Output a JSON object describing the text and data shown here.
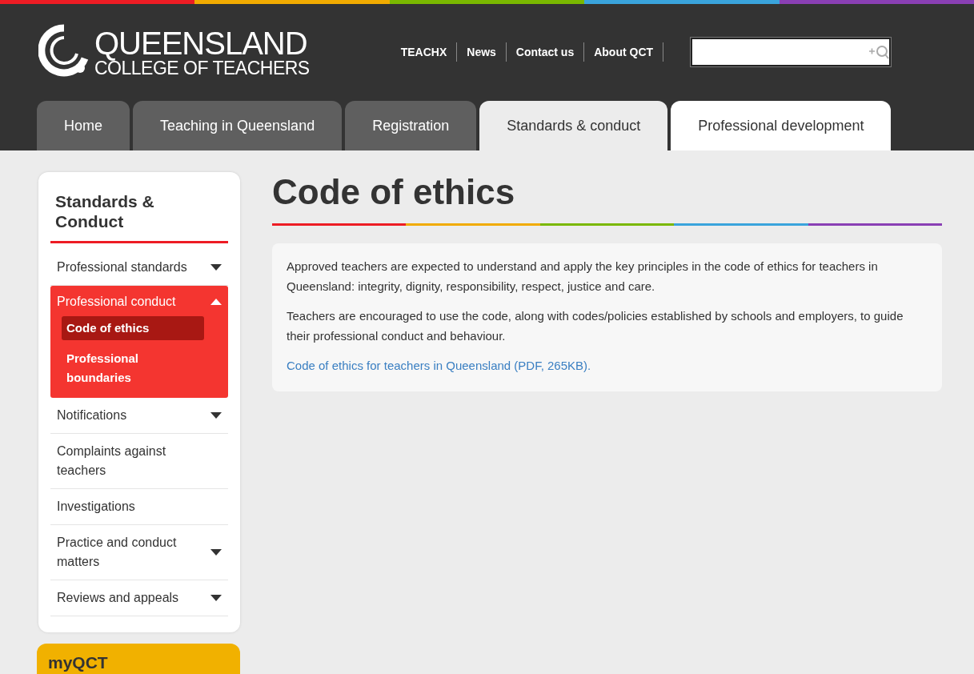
{
  "logo": {
    "line_1": "QUEENSLAND",
    "line_2": "COLLEGE OF TEACHERS"
  },
  "top_links": [
    "TEACHX",
    "News",
    "Contact us",
    "About QCT"
  ],
  "tabs": [
    {
      "label": "Home",
      "selected": false,
      "highlighted": false
    },
    {
      "label": "Teaching in Queensland",
      "selected": false,
      "highlighted": false
    },
    {
      "label": "Registration",
      "selected": false,
      "highlighted": false
    },
    {
      "label": "Standards & conduct",
      "selected": true,
      "highlighted": false
    },
    {
      "label": "Professional development",
      "selected": false,
      "highlighted": true
    }
  ],
  "sidebar": {
    "title": "Standards & Conduct",
    "items": [
      {
        "label": "Professional standards",
        "expandable": true,
        "expanded": false
      },
      {
        "label": "Professional conduct",
        "expandable": true,
        "expanded": true,
        "children": [
          {
            "label": "Code of ethics",
            "selected": true
          },
          {
            "label": "Professional boundaries",
            "selected": false
          }
        ]
      },
      {
        "label": "Notifications",
        "expandable": true,
        "expanded": false
      },
      {
        "label": "Complaints against teachers",
        "expandable": false,
        "expanded": false
      },
      {
        "label": "Investigations",
        "expandable": false,
        "expanded": false
      },
      {
        "label": "Practice and conduct matters",
        "expandable": true,
        "expanded": false
      },
      {
        "label": "Reviews and appeals",
        "expandable": true,
        "expanded": false
      }
    ]
  },
  "myqct": {
    "title": "myQCT"
  },
  "page": {
    "title": "Code of ethics",
    "paragraphs": [
      "Approved teachers are expected to understand and apply the key principles in the code of ethics for teachers in Queensland: integrity, dignity, responsibility, respect, justice and care.",
      "Teachers are encouraged to use the code, along with codes/policies established by schools and employers, to guide their professional conduct and behaviour."
    ],
    "link": "Code of ethics for teachers in Queensland (PDF, 265KB)."
  }
}
